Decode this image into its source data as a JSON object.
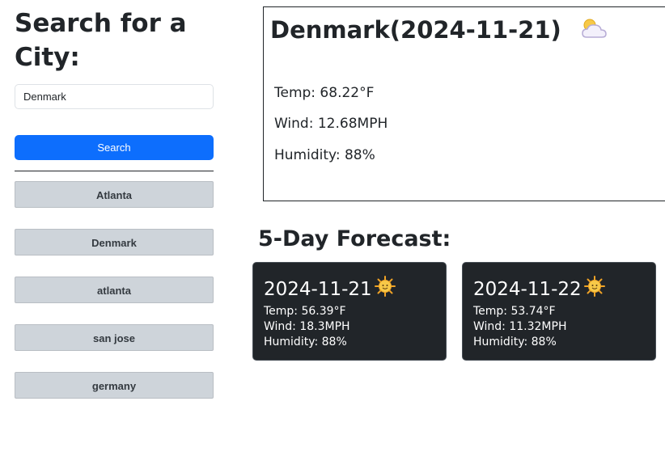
{
  "sidebar": {
    "heading": "Search for a City:",
    "search_input_value": "Denmark",
    "search_button_label": "Search",
    "history": [
      "Atlanta",
      "Denmark",
      "atlanta",
      "san jose",
      "germany"
    ]
  },
  "current": {
    "title": "Denmark(2024-11-21)",
    "icon": "partly-cloudy-icon",
    "temp": "Temp: 68.22°F",
    "wind": "Wind: 12.68MPH",
    "humidity": "Humidity: 88%"
  },
  "forecast": {
    "heading": "5-Day Forecast:",
    "days": [
      {
        "date": "2024-11-21",
        "icon": "sun-icon",
        "temp": "Temp: 56.39°F",
        "wind": "Wind: 18.3MPH",
        "humidity": "Humidity: 88%"
      },
      {
        "date": "2024-11-22",
        "icon": "sun-icon",
        "temp": "Temp: 53.74°F",
        "wind": "Wind: 11.32MPH",
        "humidity": "Humidity: 88%"
      }
    ]
  },
  "colors": {
    "primary_button": "#0d6efd",
    "history_button": "#ced4da",
    "forecast_card": "#212529",
    "sun": "#f7c948"
  }
}
